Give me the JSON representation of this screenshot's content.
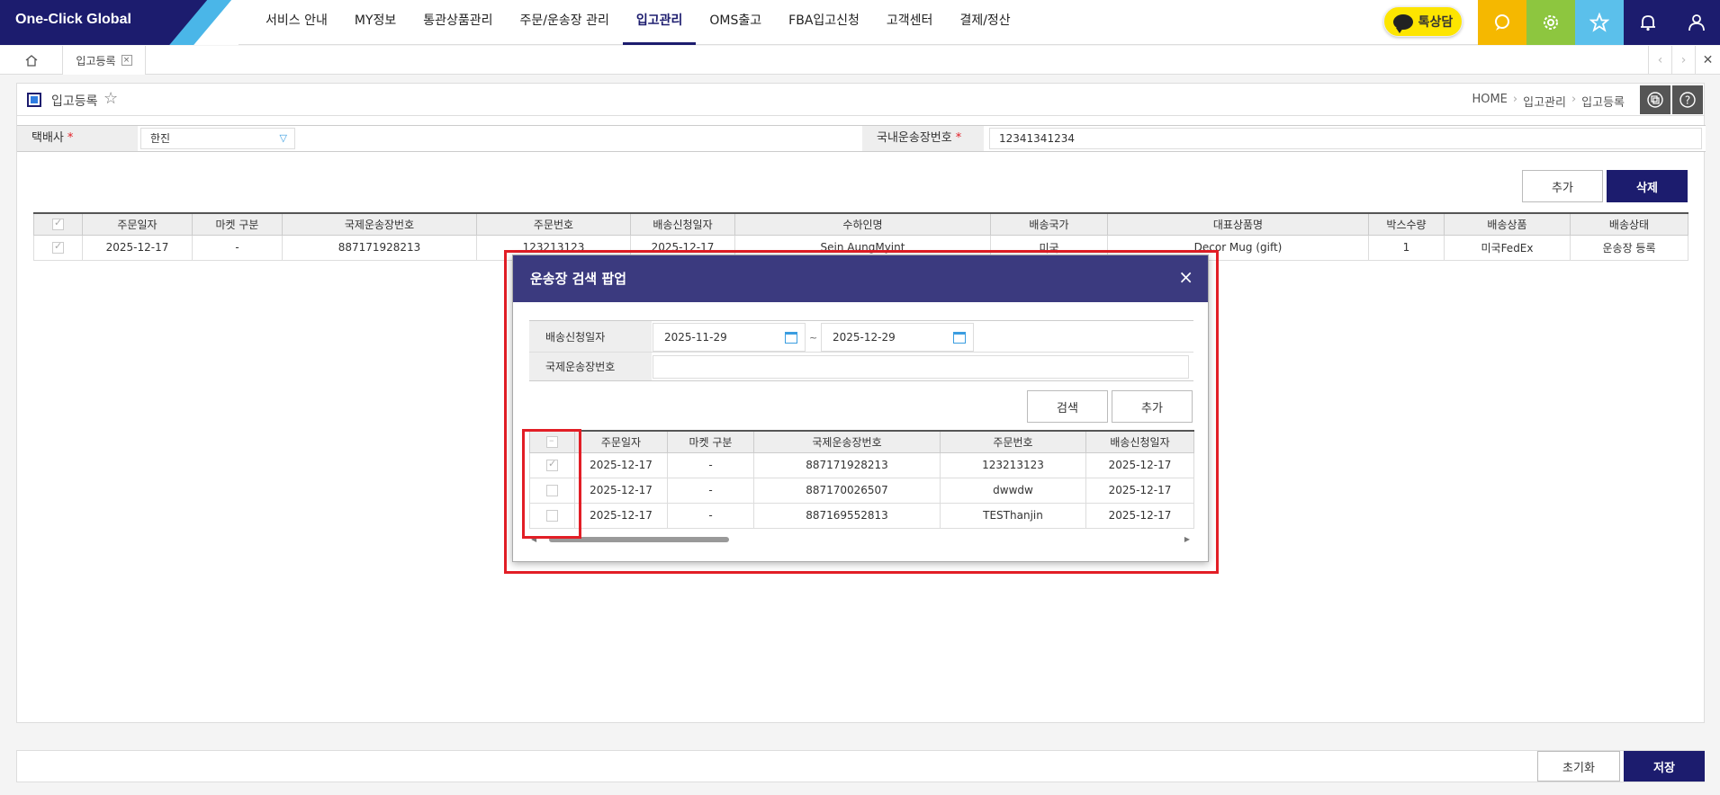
{
  "app": {
    "logo_text": "One-Click Global"
  },
  "gnb": {
    "items": [
      "서비스 안내",
      "MY정보",
      "통관상품관리",
      "주문/운송장 관리",
      "입고관리",
      "OMS출고",
      "FBA입고신청",
      "고객센터",
      "결제/정산"
    ],
    "active_index": 4
  },
  "talk": {
    "label": "톡상담"
  },
  "top_icons": [
    {
      "name": "chat-search-icon",
      "color": "#f5b800"
    },
    {
      "name": "settings-icon",
      "color": "#8dc63f"
    },
    {
      "name": "star-icon",
      "color": "#5bc0eb"
    },
    {
      "name": "bell-icon",
      "color": "#1c1c6e"
    },
    {
      "name": "user-icon",
      "color": "#1c1c6e"
    }
  ],
  "tabs": {
    "current": "입고등록",
    "close": "×",
    "prev": "‹",
    "next": "›",
    "close_all": "✕"
  },
  "page": {
    "title": "입고등록"
  },
  "breadcrumb": [
    "HOME",
    "입고관리",
    "입고등록"
  ],
  "filters": {
    "courier_label": "택배사",
    "courier_value": "한진",
    "tracking_label": "국내운송장번호",
    "tracking_value": "12341341234",
    "required_mark": "*"
  },
  "buttons": {
    "add": "추가",
    "delete": "삭제",
    "reset": "초기화",
    "save": "저장"
  },
  "main_table": {
    "columns": [
      "주문일자",
      "마켓 구분",
      "국제운송장번호",
      "주문번호",
      "배송신청일자",
      "수하인명",
      "배송국가",
      "대표상품명",
      "박스수량",
      "배송상품",
      "배송상태"
    ],
    "rows": [
      [
        "2025-12-17",
        "-",
        "887171928213",
        "123213123",
        "2025-12-17",
        "Sein AungMyint",
        "미국",
        "Decor Mug (gift)",
        "1",
        "미국FedEx",
        "운송장 등록"
      ]
    ]
  },
  "modal": {
    "title": "운송장 검색 팝업",
    "close": "×",
    "date_label": "배송신청일자",
    "date_from": "2025-11-29",
    "date_to": "2025-12-29",
    "date_sep": "~",
    "tracking_label": "국제운송장번호",
    "tracking_value": "",
    "search_button": "검색",
    "add_button": "추가",
    "table": {
      "columns": [
        "주문일자",
        "마켓 구분",
        "국제운송장번호",
        "주문번호",
        "배송신청일자"
      ],
      "rows": [
        {
          "checked": true,
          "cells": [
            "2025-12-17",
            "-",
            "887171928213",
            "123213123",
            "2025-12-17"
          ]
        },
        {
          "checked": false,
          "cells": [
            "2025-12-17",
            "-",
            "887170026507",
            "dwwdw",
            "2025-12-17"
          ]
        },
        {
          "checked": false,
          "cells": [
            "2025-12-17",
            "-",
            "887169552813",
            "TESThanjin",
            "2025-12-17"
          ]
        }
      ]
    }
  }
}
